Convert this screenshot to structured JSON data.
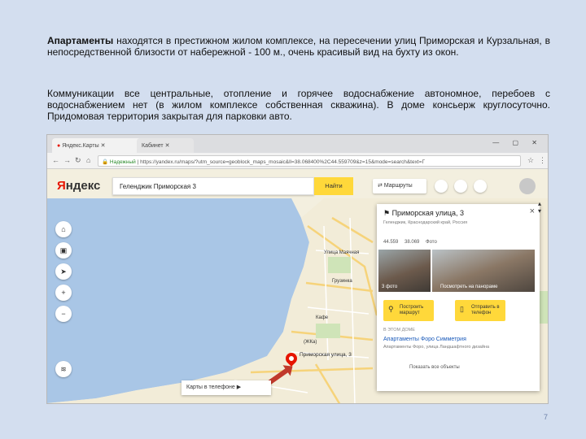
{
  "document": {
    "p1_bold": "Апартаменты",
    "p1_rest": " находятся в престижном жилом комплексе, на пересечении улиц Приморская и Курзальная, в непосредственной близости от набережной - 100 м., очень красивый вид на бухту из окон.",
    "p2": "Коммуникации все центральные, отопление и горячее водоснабжение автономное, перебоев с водоснабжением нет (в жилом комплексе собственная скважина). В доме консьерж круглосуточно. Придомовая территория закрытая для парковки авто.",
    "slide_number": "7"
  },
  "browser": {
    "tab1": "Яндекс.Карты",
    "tab2": "Кабинет",
    "url_secure": "Надежный",
    "url": "https://yandex.ru/maps/?utm_source=geoblock_maps_mosaic&ll=38.068400%2C44.559709&z=15&mode=search&text=Г",
    "window_controls": "— ▢ ✕"
  },
  "map": {
    "logo_ya": "Я",
    "logo_rest": "ндекс",
    "search_value": "Геленджик Приморская 3",
    "find_button": "Найти",
    "routes_button": "Маршруты",
    "pin_label": "Приморская улица, 3",
    "bottom_app": "Карты в телефоне",
    "labels": [
      "Улица Маячная",
      "Грузинка",
      "Кафе",
      "(ЖКа)"
    ]
  },
  "card": {
    "title": "Приморская улица, 3",
    "close": "×",
    "subtitle": "Геленджик, Краснодарский край, Россия",
    "meta": "44.559 38.069 Фото",
    "photo1_label": "3 фото",
    "photo2_label": "Посмотреть на панораме",
    "act1": "Построить маршрут",
    "act2": "Отправить в телефон",
    "section": "В ЭТОМ ДОМЕ",
    "link": "Апартаменты Форо Симметрия",
    "desc": "Апартаменты Форо, улица Ландшафтного дизайна",
    "all": "Показать все объекты"
  }
}
